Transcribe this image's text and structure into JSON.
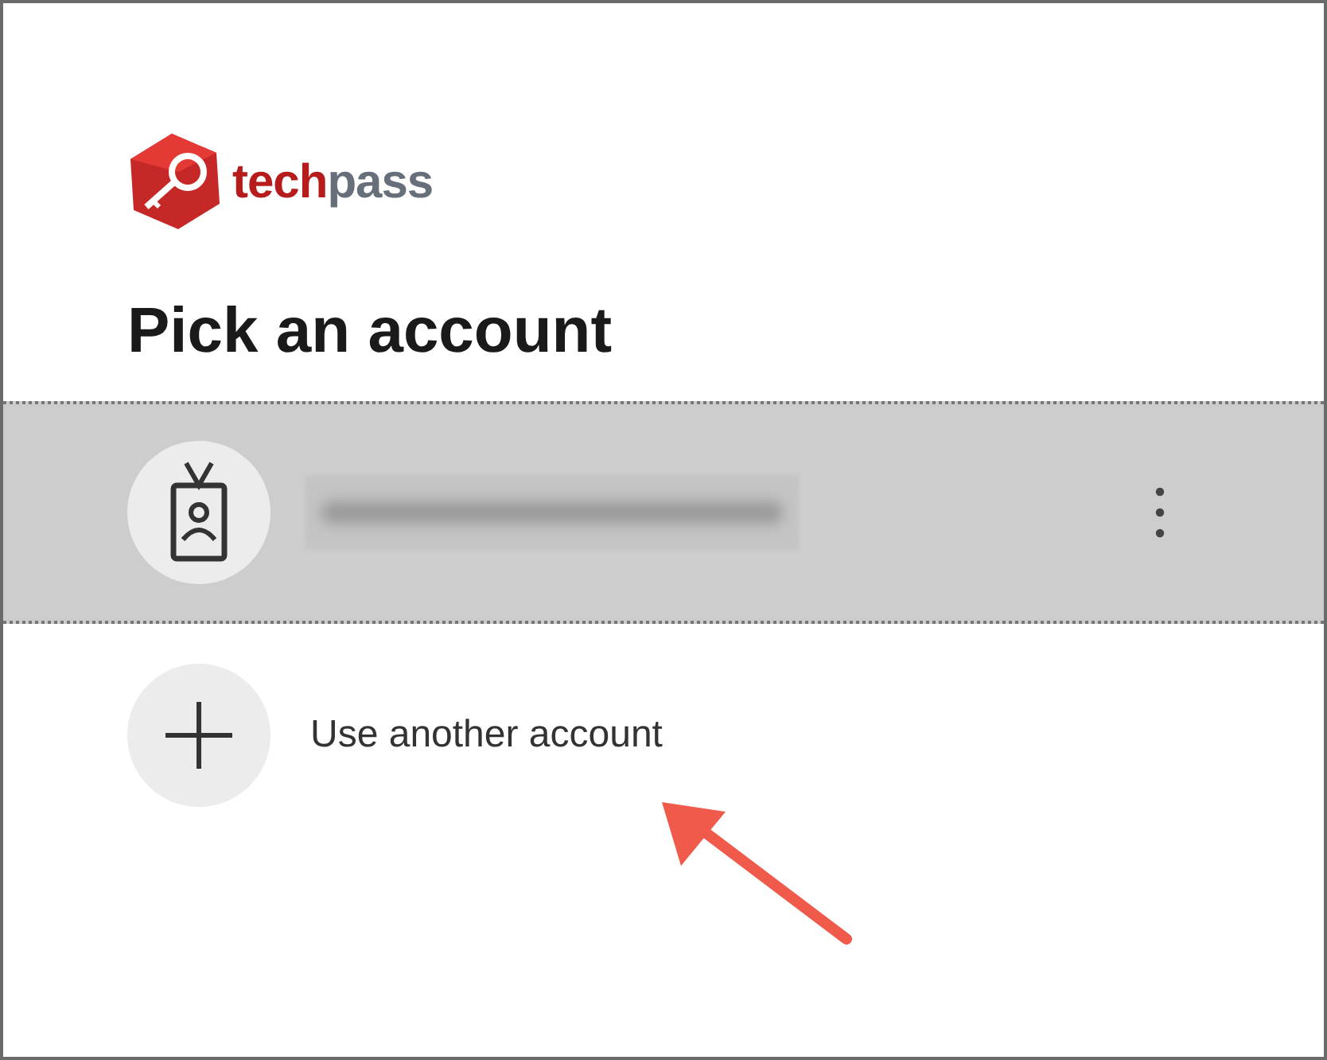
{
  "logo": {
    "brand_primary": "tech",
    "brand_secondary": "pass"
  },
  "heading": "Pick an account",
  "accounts": [
    {
      "kind": "account",
      "redacted": true,
      "selected": true
    },
    {
      "kind": "add",
      "label": "Use another account",
      "selected": false
    }
  ],
  "annotation": {
    "kind": "arrow"
  }
}
